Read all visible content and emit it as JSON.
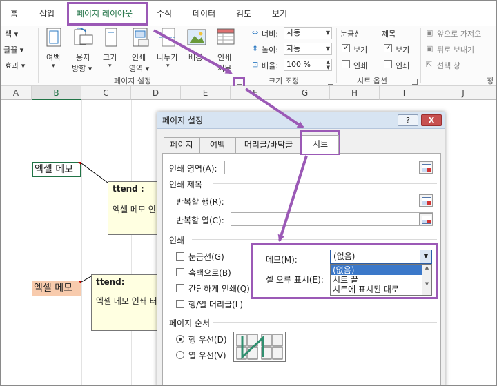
{
  "tabs": [
    "홈",
    "삽입",
    "페이지 레이아웃",
    "수식",
    "데이터",
    "검토",
    "보기"
  ],
  "ribbon": {
    "partial_left": [
      "색 ▾",
      "글꼴 ▾",
      "효과 ▾"
    ],
    "buttons": [
      {
        "label1": "여백",
        "label2": "▾"
      },
      {
        "label1": "용지",
        "label2": "방향 ▾"
      },
      {
        "label1": "크기",
        "label2": "▾"
      },
      {
        "label1": "인쇄",
        "label2": "영역 ▾"
      },
      {
        "label1": "나누기",
        "label2": "▾"
      },
      {
        "label1": "배경",
        "label2": ""
      },
      {
        "label1": "인쇄",
        "label2": "제목"
      }
    ],
    "group_page_setup": "페이지 설정",
    "scale": {
      "width_label": "너비:",
      "width_value": "자동",
      "height_label": "높이:",
      "height_value": "자동",
      "scale_label": "배율:",
      "scale_value": "100 %",
      "group": "크기 조정"
    },
    "sheet_options": {
      "gridlines": "눈금선",
      "headings": "제목",
      "view": "보기",
      "print": "인쇄",
      "group": "시트 옵션"
    },
    "arrange": {
      "forward": "앞으로 가져오",
      "backward": "뒤로 보내기",
      "selection": "선택 창",
      "group_partial": "정"
    }
  },
  "columns": [
    "A",
    "B",
    "C",
    "D",
    "E",
    "F",
    "G",
    "H",
    "I",
    "J"
  ],
  "cells": {
    "memo1": "엑셀 메모",
    "memo2": "엑셀 메모"
  },
  "notes": {
    "note1": {
      "author": "ttend :",
      "text": "엑셀 메모 인"
    },
    "note2": {
      "author": "ttend:",
      "text": "엑셀 메모 인쇄 터"
    }
  },
  "dialog": {
    "title": "페이지 설정",
    "help": "?",
    "close": "X",
    "tabs": [
      "페이지",
      "여백",
      "머리글/바닥글",
      "시트"
    ],
    "print_area_label": "인쇄 영역(A):",
    "print_titles_label": "인쇄 제목",
    "rows_repeat_label": "반복할 행(R):",
    "cols_repeat_label": "반복할 열(C):",
    "print_section": "인쇄",
    "checks": [
      "눈금선(G)",
      "흑백으로(B)",
      "간단하게 인쇄(Q)",
      "행/열 머리글(L)"
    ],
    "comments_label": "메모(M):",
    "comments_value": "(없음)",
    "errors_label": "셀 오류 표시(E):",
    "comments_options": [
      "(없음)",
      "시트 끝",
      "시트에 표시된 대로"
    ],
    "page_order_label": "페이지 순서",
    "order_options": [
      "행 우선(D)",
      "열 우선(V)"
    ],
    "order_selected": 0
  },
  "colors": {
    "highlight": "#9b59b6",
    "excel_green": "#217346",
    "note_bg": "#ffffe1",
    "cell_fill": "#f8cbad",
    "list_select": "#3b78c9"
  }
}
